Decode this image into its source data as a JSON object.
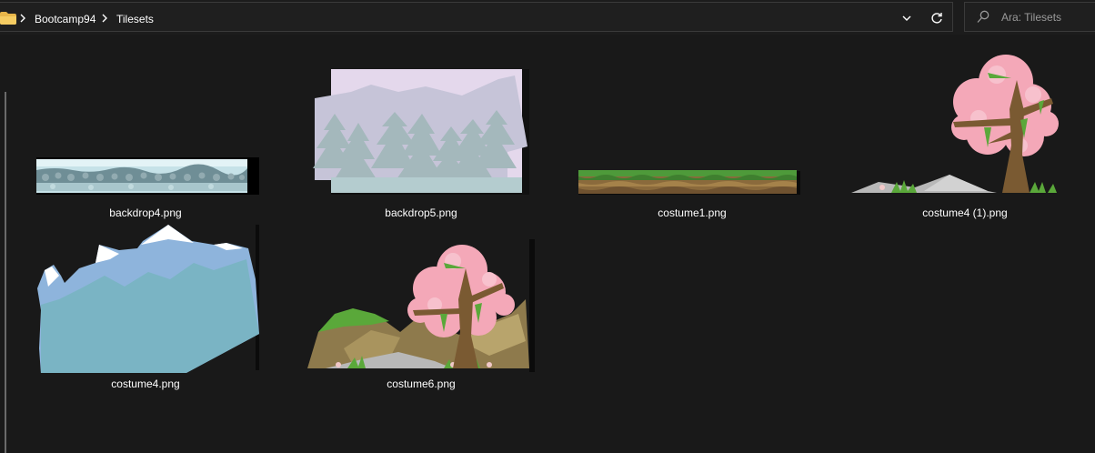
{
  "breadcrumb": {
    "items": [
      "Bootcamp94",
      "Tilesets"
    ]
  },
  "search": {
    "placeholder": "Ara: Tilesets"
  },
  "icons": {
    "folder": "folder-icon",
    "separator": "chevron-right-icon",
    "history": "chevron-down-icon",
    "refresh": "refresh-icon",
    "search": "search-icon"
  },
  "colors": {
    "background": "#191919",
    "folder": "#e8b64a",
    "text": "#ffffff"
  },
  "files": [
    {
      "name": "backdrop4.png"
    },
    {
      "name": "backdrop5.png"
    },
    {
      "name": "costume1.png"
    },
    {
      "name": "costume4 (1).png"
    },
    {
      "name": "costume4.png"
    },
    {
      "name": "costume6.png"
    }
  ]
}
